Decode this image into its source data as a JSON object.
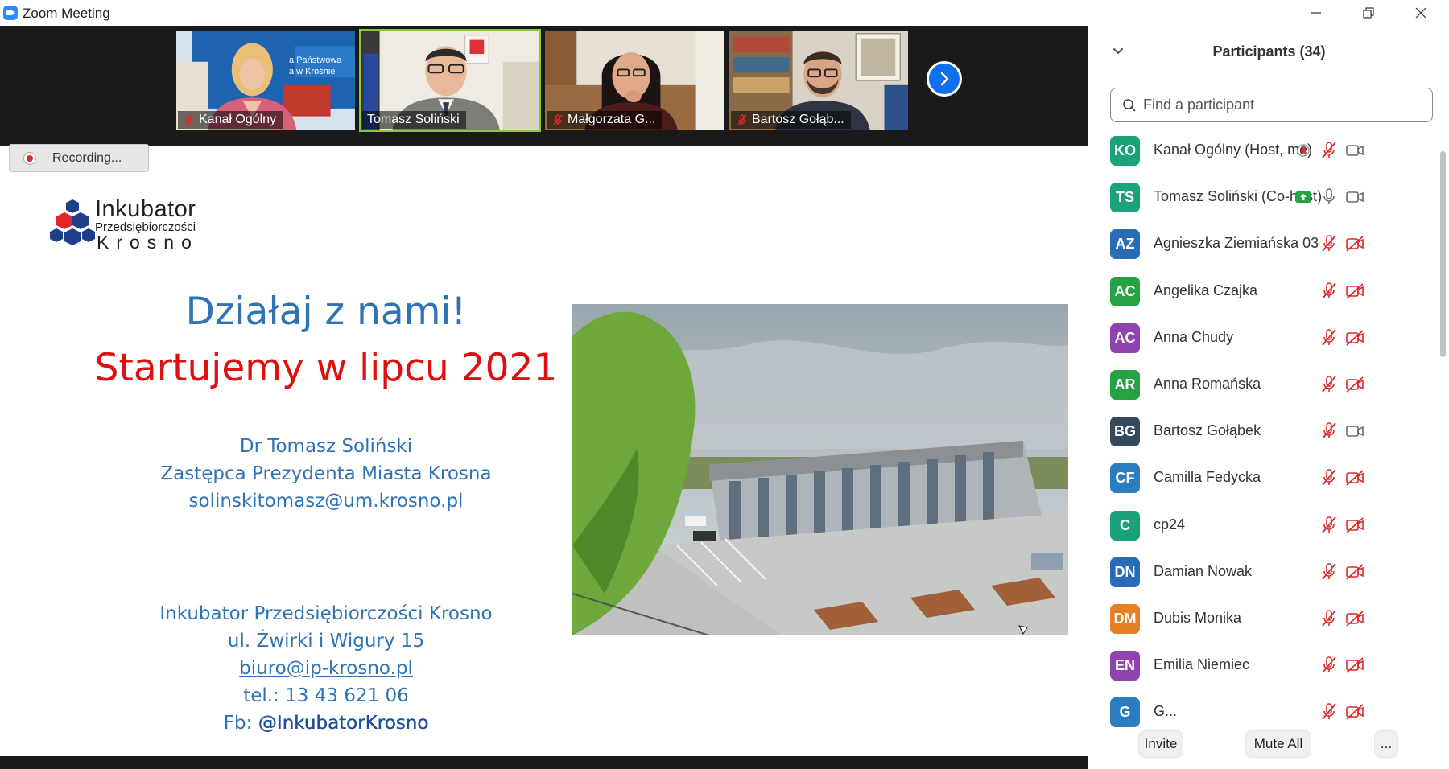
{
  "window": {
    "title": "Zoom Meeting",
    "icons": [
      "zoom-logo-icon",
      "minimize-icon",
      "restore-icon",
      "close-icon"
    ]
  },
  "video_strip": {
    "tiles": [
      {
        "name": "Kanał Ogólny",
        "muted": true,
        "sign_line1": "a Państwowa",
        "sign_line2": "a w Krośnie"
      },
      {
        "name": "Tomasz Soliński",
        "muted": false,
        "active_speaker": true
      },
      {
        "name": "Małgorzata G...",
        "muted": true
      },
      {
        "name": "Bartosz Gołąb...",
        "muted": true
      }
    ],
    "next_icon": "chevron-right-icon",
    "speaker_border_color": "#8cc63f"
  },
  "recording": {
    "label": "Recording..."
  },
  "slide": {
    "logo": {
      "name": "Inkubator",
      "sub": "Przedsiębiorczości",
      "city": "Krosno"
    },
    "headline_1": "Działaj z nami!",
    "headline_2": "Startujemy w lipcu 2021",
    "speaker_name": "Dr Tomasz Soliński",
    "speaker_role": "Zastępca Prezydenta Miasta Krosna",
    "speaker_email": "solinskitomasz@um.krosno.pl",
    "org_name": "Inkubator Przedsiębiorczości Krosno",
    "org_address": "ul. Żwirki i Wigury 15",
    "org_email": "biuro@ip-krosno.pl",
    "org_phone": "tel.: 13 43 621 06",
    "org_fb_prefix": "Fb: ",
    "org_fb_handle": "@InkubatorKrosno",
    "colors": {
      "blue": "#2e74b5",
      "red": "#e01010"
    }
  },
  "participants": {
    "title": "Participants (34)",
    "search_placeholder": "Find a participant",
    "list": [
      {
        "initials": "KO",
        "name": "Kanał Ogólny (Host, me)",
        "color": "#1aa37a",
        "mic": "muted",
        "video": "on",
        "recording": true
      },
      {
        "initials": "TS",
        "name": "Tomasz Soliński (Co-host)",
        "color": "#1aa37a",
        "mic": "on",
        "video": "on",
        "sharing": true
      },
      {
        "initials": "AZ",
        "name": "Agnieszka Ziemiańska 03",
        "color": "#2a6bb8",
        "mic": "muted",
        "video": "off"
      },
      {
        "initials": "AC",
        "name": "Angelika Czajka",
        "color": "#25a244",
        "mic": "muted",
        "video": "off"
      },
      {
        "initials": "AC",
        "name": "Anna Chudy",
        "color": "#8e44ad",
        "mic": "muted",
        "video": "off"
      },
      {
        "initials": "AR",
        "name": "Anna Romańska",
        "color": "#25a244",
        "mic": "muted",
        "video": "off"
      },
      {
        "initials": "BG",
        "name": "Bartosz Gołąbek",
        "color": "#34495e",
        "mic": "muted",
        "video": "on"
      },
      {
        "initials": "CF",
        "name": "Camilla Fedycka",
        "color": "#2a7ec0",
        "mic": "muted",
        "video": "off"
      },
      {
        "initials": "C",
        "name": "cp24",
        "color": "#1aa37a",
        "mic": "muted",
        "video": "off"
      },
      {
        "initials": "DN",
        "name": "Damian Nowak",
        "color": "#2a6bb8",
        "mic": "muted",
        "video": "off"
      },
      {
        "initials": "DM",
        "name": "Dubis Monika",
        "color": "#e67e22",
        "mic": "muted",
        "video": "off"
      },
      {
        "initials": "EN",
        "name": "Emilia Niemiec",
        "color": "#8e44ad",
        "mic": "muted",
        "video": "off"
      },
      {
        "initials": "G",
        "name": "G...",
        "color": "#2a7ec0",
        "mic": "muted",
        "video": "off"
      }
    ],
    "buttons": {
      "invite": "Invite",
      "mute_all": "Mute All",
      "more": "..."
    }
  }
}
